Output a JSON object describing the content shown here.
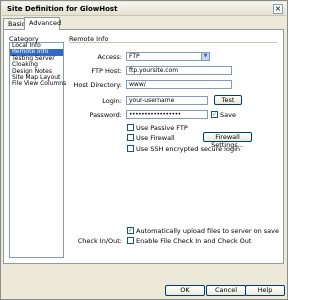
{
  "window": {
    "title": "Site Definition for GlowHost",
    "close_glyph": "×"
  },
  "tabs": [
    {
      "label": "Basic",
      "active": false
    },
    {
      "label": "Advanced",
      "active": true
    }
  ],
  "category": {
    "label": "Category",
    "items": [
      "Local Info",
      "Remote Info",
      "Testing Server",
      "Cloaking",
      "Design Notes",
      "Site Map Layout",
      "File View Columns"
    ],
    "selected": "Remote Info"
  },
  "remote_info": {
    "title": "Remote Info",
    "access_label": "Access:",
    "access_value": "FTP",
    "ftp_host_label": "FTP Host:",
    "ftp_host_value": "ftp.yoursite.com",
    "host_directory_label": "Host Directory:",
    "host_directory_value": "www/",
    "login_label": "Login:",
    "login_value": "your-username",
    "test_button": "Test",
    "password_label": "Password:",
    "password_value": "•••••••••••••••••",
    "save_label": "Save",
    "save_checked": true,
    "passive_ftp_label": "Use Passive FTP",
    "passive_ftp_checked": false,
    "firewall_label": "Use Firewall",
    "firewall_checked": false,
    "firewall_settings_button": "Firewall Settings...",
    "ssh_label": "Use SSH encrypted secure login",
    "ssh_checked": false,
    "auto_upload_label": "Automatically upload files to server on save",
    "auto_upload_checked": true,
    "checkinout_label": "Check In/Out:",
    "checkinout_option_label": "Enable File Check In and Check Out",
    "checkinout_checked": false
  },
  "footer": {
    "ok": "OK",
    "cancel": "Cancel",
    "help": "Help"
  },
  "colors": {
    "selection": "#316ac5",
    "dialog_bg": "#ece9d8",
    "check_green": "#21a121"
  }
}
